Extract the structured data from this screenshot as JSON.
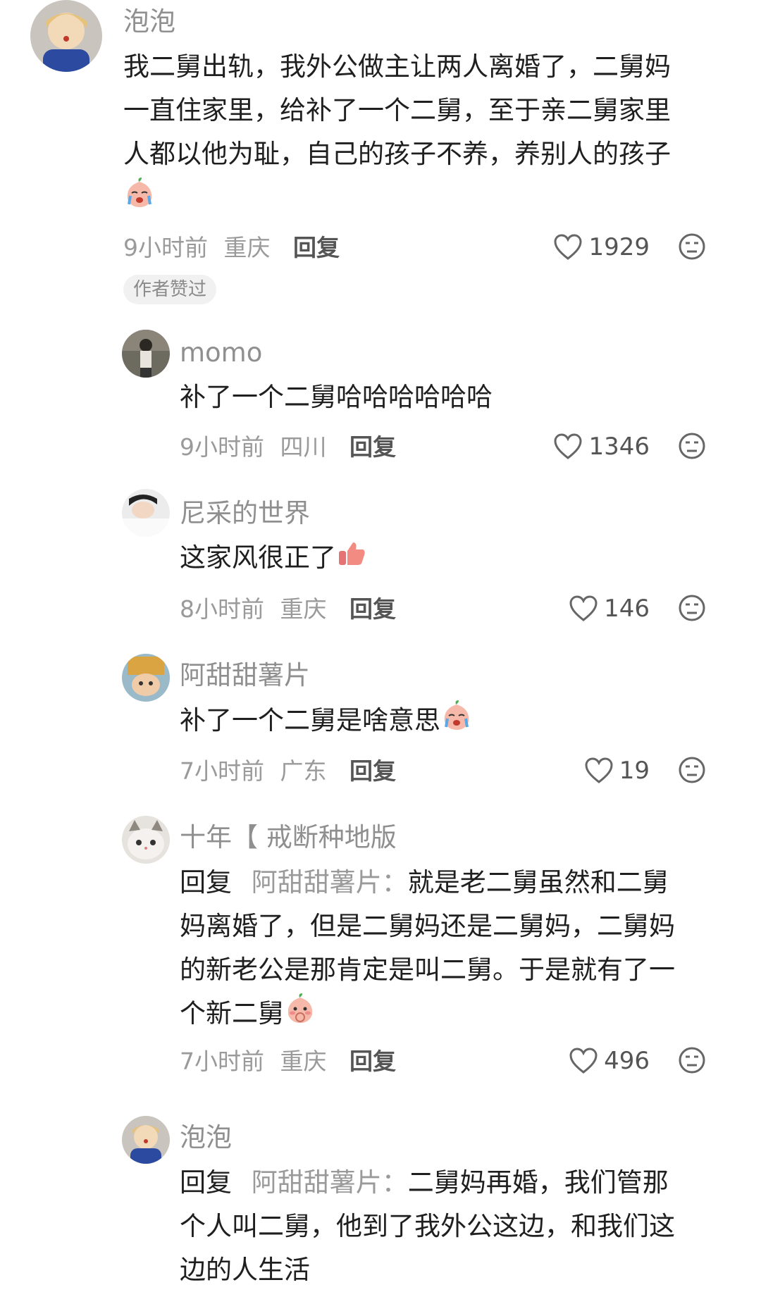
{
  "comments": [
    {
      "username": "泡泡",
      "avatar": "blonde-child-avatar",
      "lines": [
        "我二舅出轨，我外公做主让两人离婚了，二舅妈",
        "一直住家里，给补了一个二舅，至于亲二舅家里",
        "人都以他为耻，自己的孩子不养，养别人的孩子"
      ],
      "emoji": "crying-peach-emoji",
      "time": "9小时前",
      "location": "重庆",
      "reply_label": "回复",
      "likes": "1929",
      "badge": "作者赞过"
    },
    {
      "username": "momo",
      "avatar": "person-photo-avatar",
      "lines": [
        "补了一个二舅哈哈哈哈哈哈"
      ],
      "time": "9小时前",
      "location": "四川",
      "reply_label": "回复",
      "likes": "1346"
    },
    {
      "username": "尼采的世界",
      "avatar": "sleeping-person-avatar",
      "lines": [
        "这家风很正了"
      ],
      "emoji": "thumbs-up-emoji",
      "time": "8小时前",
      "location": "重庆",
      "reply_label": "回复",
      "likes": "146"
    },
    {
      "username": "阿甜甜薯片",
      "avatar": "box-hat-child-avatar",
      "lines": [
        "补了一个二舅是啥意思"
      ],
      "emoji": "crying-peach-emoji",
      "time": "7小时前",
      "location": "广东",
      "reply_label": "回复",
      "likes": "19"
    },
    {
      "username": "十年【 戒断种地版",
      "avatar": "cat-avatar",
      "reply_prefix": "回复",
      "reply_to": "阿甜甜薯片：",
      "lines": [
        "就是老二舅虽然和二舅",
        "妈离婚了，但是二舅妈还是二舅妈，二舅妈",
        "的新老公是那肯定是叫二舅。于是就有了一",
        "个新二舅"
      ],
      "emoji": "shy-peach-emoji",
      "time": "7小时前",
      "location": "重庆",
      "reply_label": "回复",
      "likes": "496"
    },
    {
      "username": "泡泡",
      "avatar": "blonde-child-avatar",
      "reply_prefix": "回复",
      "reply_to": "阿甜甜薯片：",
      "lines": [
        "二舅妈再婚，我们管那",
        "个人叫二舅，他到了我外公这边，和我们这",
        "边的人生活"
      ]
    }
  ],
  "colors": {
    "text": "#1f1f1f",
    "meta": "#9a9a9a",
    "username": "#8f8f8f",
    "reply": "#555555"
  }
}
